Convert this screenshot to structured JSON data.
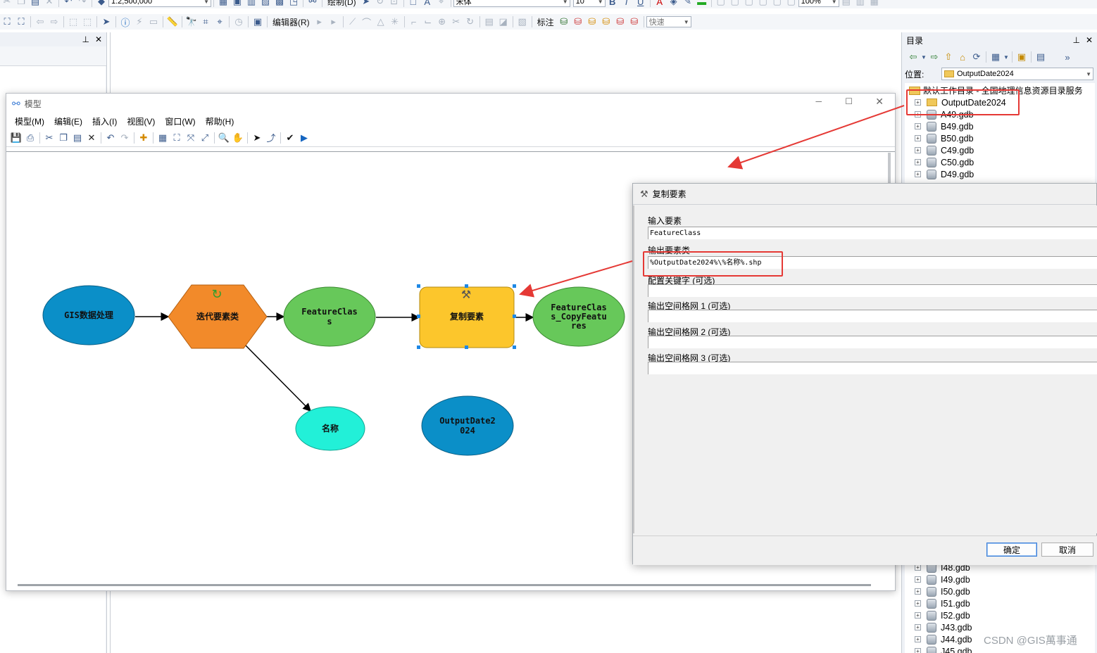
{
  "toolbar": {
    "scale_value": "1:2,500,000",
    "draw_menu": "绘制(D)",
    "font_name": "宋体",
    "font_size": "10",
    "zoom_value": "100%",
    "editor_menu": "编辑器(R)",
    "label_menu": "标注",
    "quick_label": "快速"
  },
  "catalog": {
    "title": "目录",
    "location_label": "位置:",
    "location_value": "OutputDate2024",
    "root_item": "默认工作目录 - 全国地理信息资源目录服务",
    "folder_item": "OutputDate2024",
    "items_top": [
      "A49.gdb",
      "B49.gdb",
      "B50.gdb",
      "C49.gdb",
      "C50.gdb",
      "D49.gdb"
    ],
    "items_bottom": [
      "I48.gdb",
      "I49.gdb",
      "I50.gdb",
      "I51.gdb",
      "I52.gdb",
      "J43.gdb",
      "J44.gdb",
      "J45.gdb"
    ]
  },
  "model_window": {
    "title": "模型",
    "menu": [
      "模型(M)",
      "编辑(E)",
      "插入(I)",
      "视图(V)",
      "窗口(W)",
      "帮助(H)"
    ],
    "nodes": {
      "gis": "GIS数据处理",
      "iterate": "迭代要素类",
      "feature_class_1": "FeatureClas",
      "feature_class_2": "s",
      "copy_tool": "复制要素",
      "output_1": "FeatureClas",
      "output_2": "s_CopyFeatu",
      "output_3": "res",
      "name": "名称",
      "output_date_1": "OutputDate2",
      "output_date_2": "024"
    }
  },
  "dialog": {
    "title": "复制要素",
    "fields": [
      {
        "label": "输入要素",
        "value": "FeatureClass"
      },
      {
        "label": "输出要素类",
        "value": "%OutputDate2024%\\%名称%.shp"
      },
      {
        "label": "配置关键字 (可选)",
        "value": ""
      },
      {
        "label": "输出空间格网 1 (可选)",
        "value": ""
      },
      {
        "label": "输出空间格网 2 (可选)",
        "value": ""
      },
      {
        "label": "输出空间格网 3 (可选)",
        "value": ""
      }
    ],
    "ok_button": "确定",
    "cancel_button": "取消"
  },
  "watermark": "CSDN @GIS萬事通",
  "colors": {
    "highlight_red": "#e53935",
    "node_blue": "#0b8fc8",
    "node_orange": "#f28a2a",
    "node_green": "#67c85a",
    "node_yellow": "#fcc62c",
    "node_cyan": "#22f0d8"
  }
}
